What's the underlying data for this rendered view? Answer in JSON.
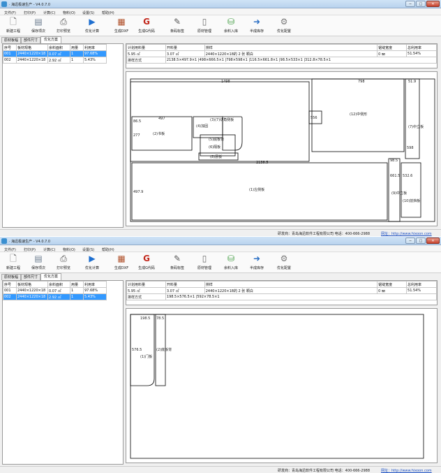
{
  "app": {
    "title": "· 海迅极速生产 - V4.0.7.0",
    "min_symbol": "─",
    "max_symbol": "□",
    "close_symbol": "✕"
  },
  "menu": [
    "文件(F)",
    "打印(P)",
    "计算(C)",
    "物料(O)",
    "设置(S)",
    "帮助(H)"
  ],
  "toolbar": [
    {
      "label": "新建工程",
      "icon": "new-project-icon",
      "glyph": "🗋",
      "color": "#555555"
    },
    {
      "label": "保存项次",
      "icon": "save-icon",
      "glyph": "▤",
      "color": "#6b7c8f"
    },
    {
      "label": "打印预览",
      "icon": "print-preview-icon",
      "glyph": "⎙",
      "color": "#4a4a4a"
    },
    {
      "label": "优化计算",
      "icon": "play-icon",
      "glyph": "▶",
      "color": "#1e6fd0"
    },
    {
      "label": "生成DXF",
      "icon": "dxf-icon",
      "glyph": "▦",
      "color": "#b0502a"
    },
    {
      "label": "生成G代码",
      "icon": "gcode-icon",
      "glyph": "G",
      "color": "#c2281c"
    },
    {
      "label": "条码标签",
      "icon": "barcode-label-icon",
      "glyph": "✎",
      "color": "#555555"
    },
    {
      "label": "原材管理",
      "icon": "material-icon",
      "glyph": "▯",
      "color": "#6b6b6b"
    },
    {
      "label": "余料入库",
      "icon": "basket-icon",
      "glyph": "⛁",
      "color": "#3d9a3d"
    },
    {
      "label": "半成库存",
      "icon": "arrow-right-icon",
      "glyph": "➜",
      "color": "#2a6fc4"
    },
    {
      "label": "优化配置",
      "icon": "gear-icon",
      "glyph": "⚙",
      "color": "#7a7a7a"
    }
  ],
  "tabs": [
    "原材板幅",
    "部件尺寸",
    "优化方案"
  ],
  "plates": {
    "headers": [
      "序号",
      "板材规格",
      "余料面积",
      "用量",
      "利用率"
    ],
    "rows": [
      [
        "001",
        "2440×1220×18",
        "0.07 ㎡",
        "1",
        "97.68%"
      ],
      [
        "002",
        "2440×1220×18",
        "2.92 ㎡",
        "1",
        "5.43%"
      ]
    ]
  },
  "detail": {
    "headers": [
      "计划用料量",
      "开料量",
      "排样",
      "锯缝宽度",
      "总利用率"
    ],
    "values": [
      "5.95 ㎡",
      "3.07 ㎡",
      "2440×1220×18的 2 张 颗白",
      "0 ㎜",
      "51.54%"
    ],
    "layout_label": "排样方式",
    "layout_value_1": "2138.5×497.9×1 |498×666.5×1 |798×598×1 |116.5×661.8×1 |98.5×533×1 |312.8×78.5×1",
    "layout_value_2": "198.5×576.5×1 |592×78.5×1"
  },
  "layout1": {
    "labels": [
      "1498",
      "798",
      "51.9",
      "556",
      "(12)中侧形",
      "(7)中立板",
      "(2)书板",
      "(3)(7)切角侧板",
      "(4)加固",
      "(5)底板背",
      "(6)隔板",
      "(8)层板",
      "86.5",
      "497",
      "277",
      "2138.5",
      "98.5",
      "(1)左侧板",
      "(9)中立板",
      "(10)前挡板",
      "497.9",
      "661.5",
      "598",
      "532.6"
    ]
  },
  "layout2": {
    "labels": [
      "198.5",
      "78.5",
      "576.5",
      "(1)门板",
      "(2)底板背"
    ]
  },
  "status": {
    "text": "研发商：青岛海迅软件工程有限公司  电话：400-666-2988",
    "link": "网址：http://www.hixoon.com"
  }
}
